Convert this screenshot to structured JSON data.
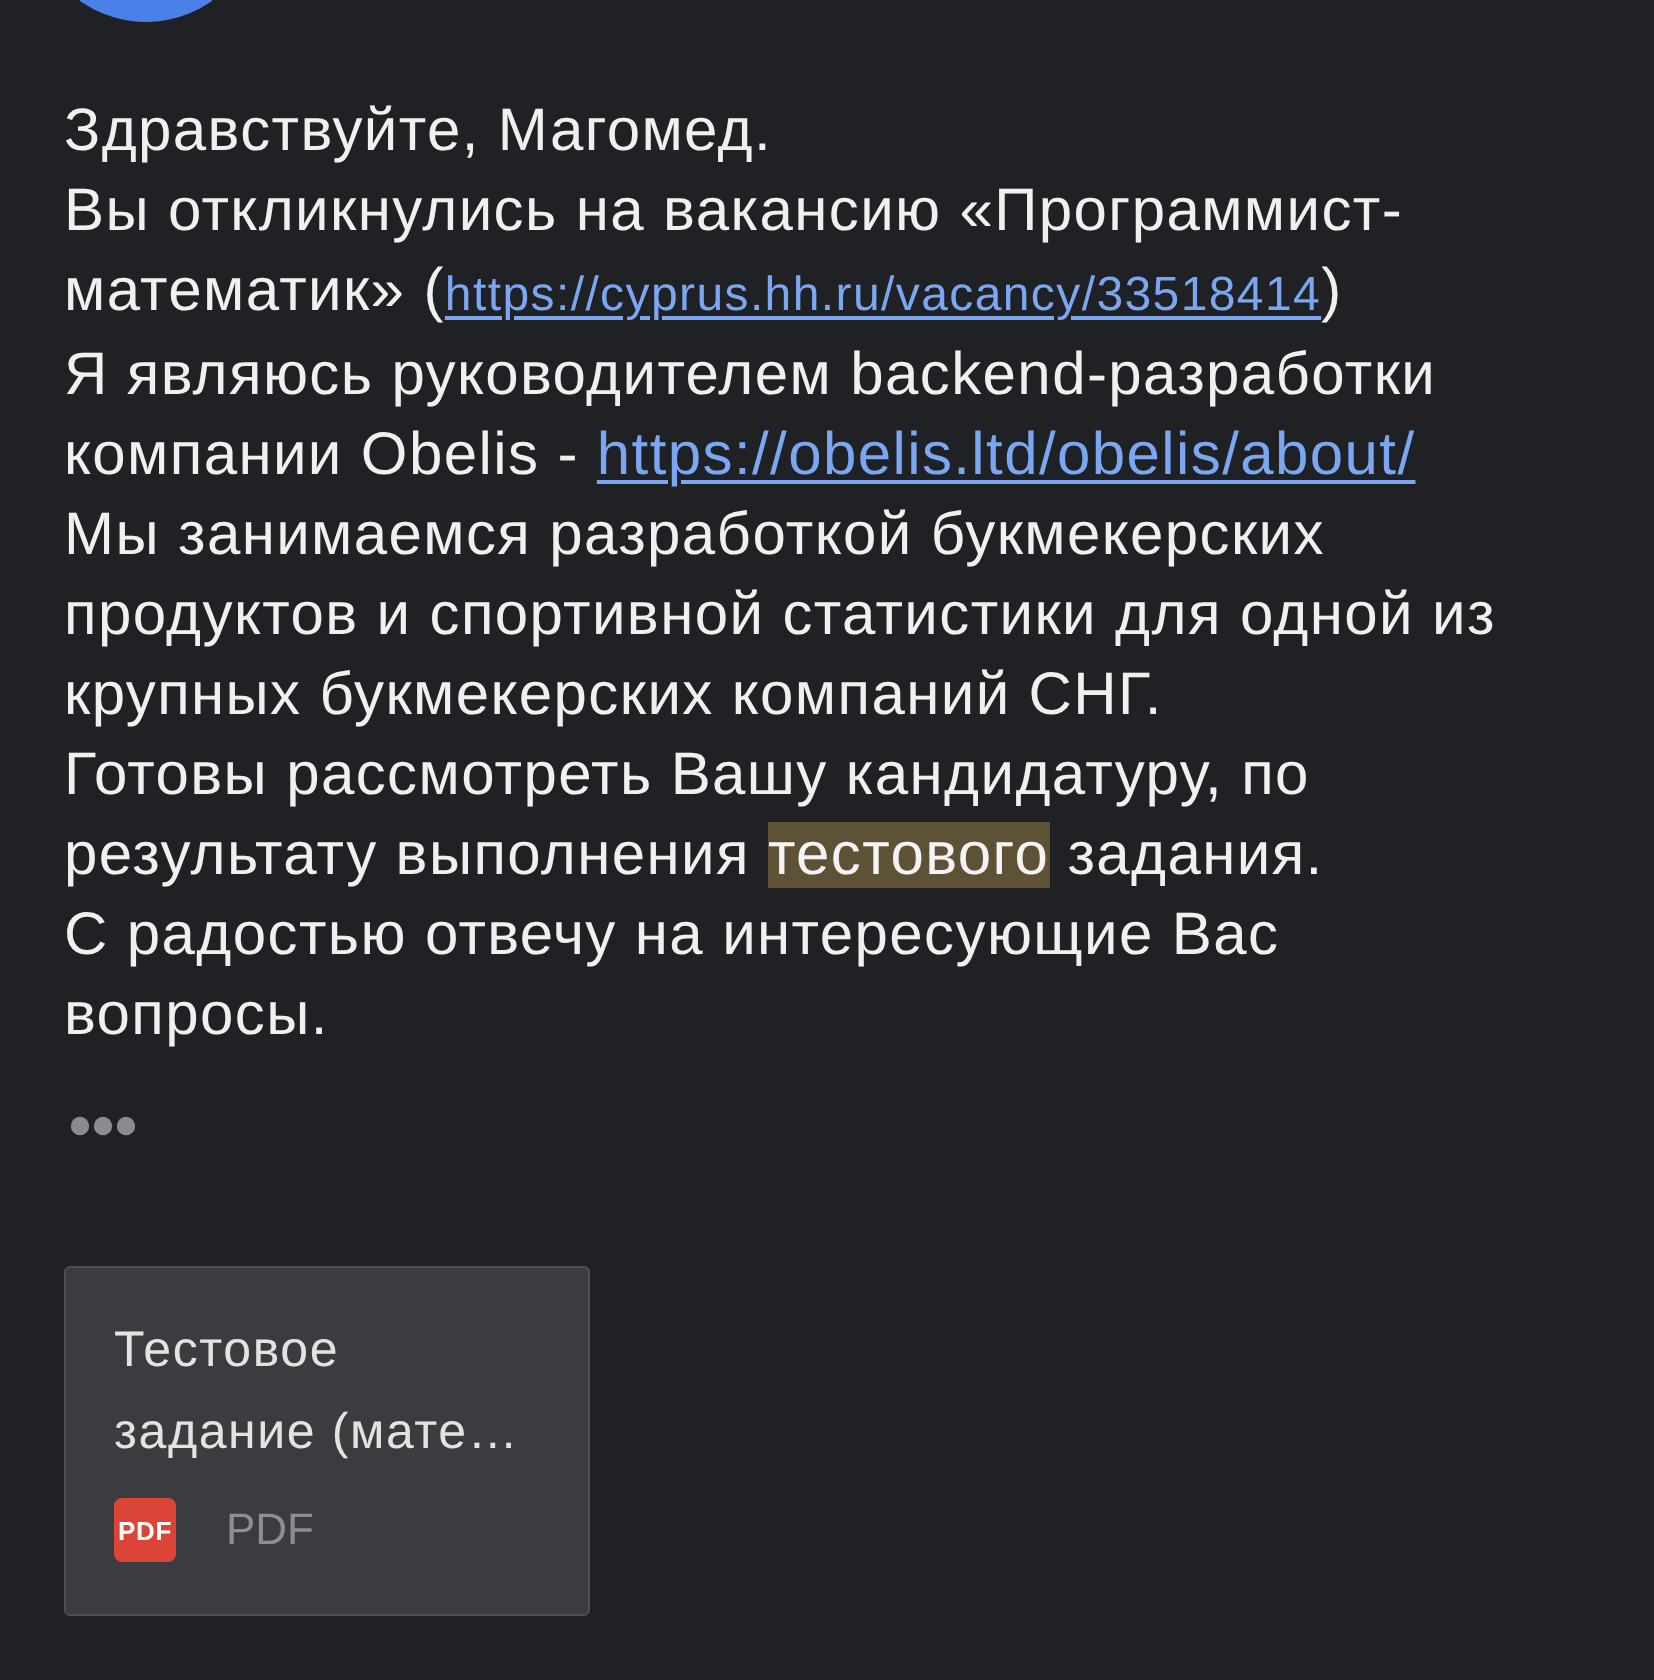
{
  "message": {
    "lines": [
      {
        "segments": [
          {
            "kind": "text",
            "text": "Здравствуйте, Магомед."
          }
        ]
      },
      {
        "segments": [
          {
            "kind": "text",
            "text": "Вы откликнулись на вакансию «Программист-математик» ("
          },
          {
            "kind": "reflink",
            "text": "https://cyprus.hh.ru/vacancy/33518414"
          },
          {
            "kind": "text",
            "text": ")"
          }
        ]
      },
      {
        "segments": [
          {
            "kind": "text",
            "text": "Я являюсь руководителем backend-разработки компании Obelis - "
          },
          {
            "kind": "link",
            "text": "https://obelis.ltd/obelis/about/"
          }
        ]
      },
      {
        "segments": [
          {
            "kind": "text",
            "text": "Мы занимаемся разработкой букмекерских продуктов и спортивной статистики для одной из крупных букмекерских компаний СНГ."
          }
        ]
      },
      {
        "segments": [
          {
            "kind": "text",
            "text": "Готовы рассмотреть Вашу кандидатуру, по результату выполнения "
          },
          {
            "kind": "highlight",
            "text": "тестового"
          },
          {
            "kind": "text",
            "text": " задания."
          }
        ]
      },
      {
        "segments": [
          {
            "kind": "text",
            "text": "С радостью отвечу на интересующие Вас вопросы."
          }
        ]
      }
    ]
  },
  "attachment": {
    "title": "Тестовое задание (мате…",
    "badge": "PDF",
    "type": "PDF"
  }
}
